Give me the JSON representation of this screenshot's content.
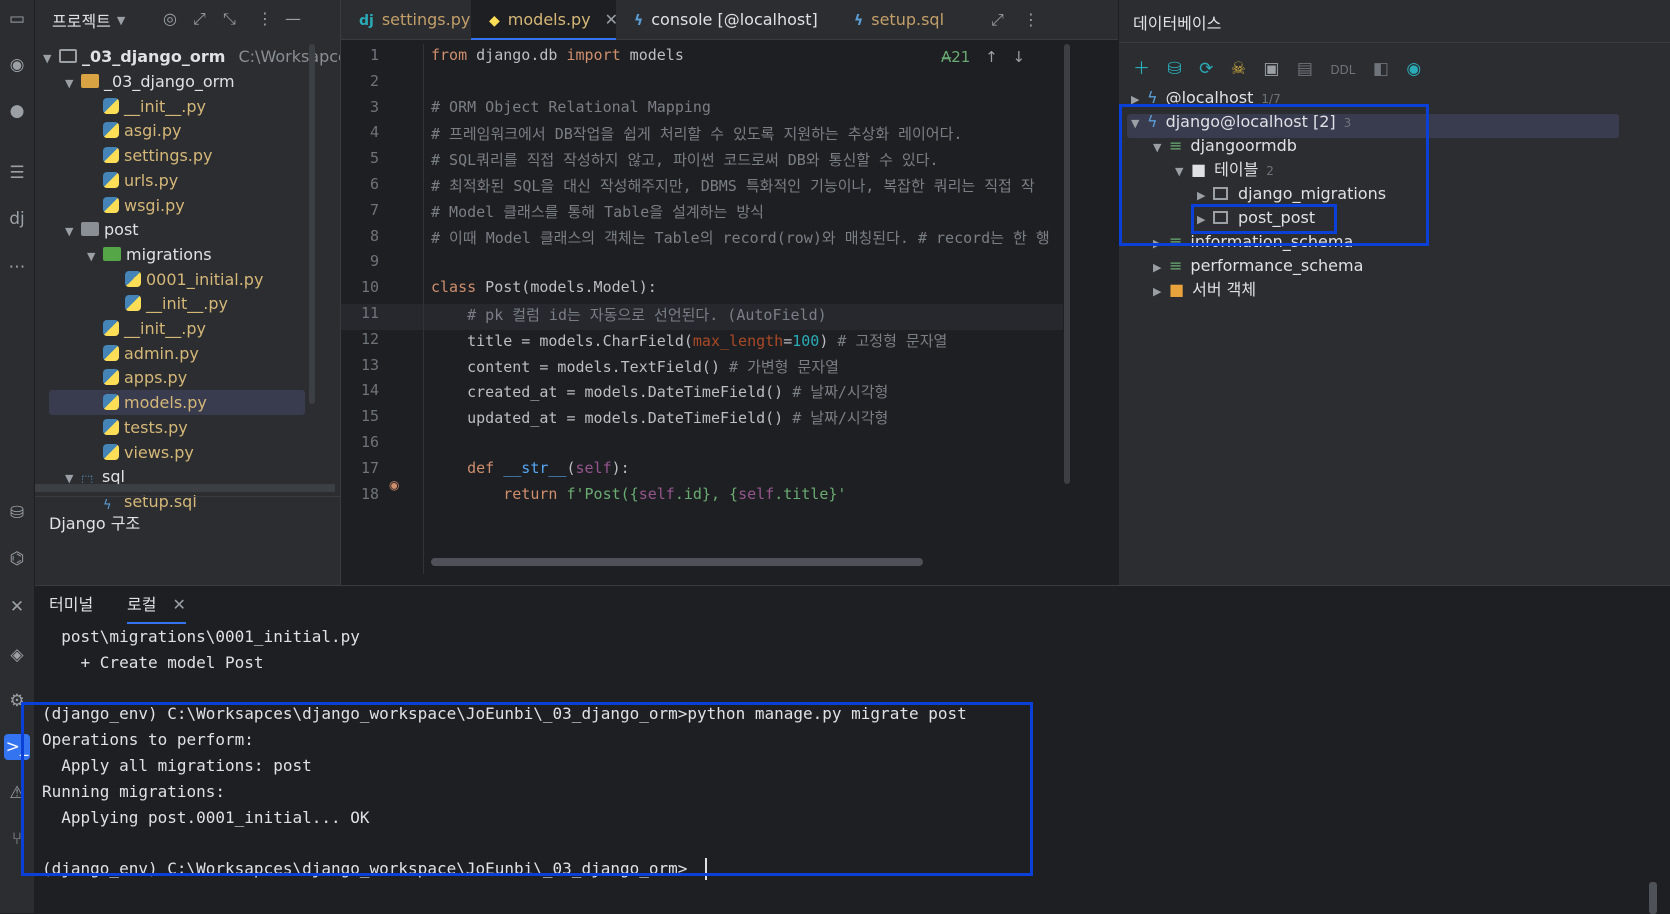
{
  "project": {
    "title": "프로젝트",
    "root": {
      "name": "_03_django_orm",
      "path": "C:\\Worksapces"
    },
    "items": [
      {
        "label": "_03_django_orm",
        "type": "folder",
        "level": 1,
        "open": true
      },
      {
        "label": "__init__.py",
        "type": "py",
        "level": 2
      },
      {
        "label": "asgi.py",
        "type": "py",
        "level": 2
      },
      {
        "label": "settings.py",
        "type": "py",
        "level": 2
      },
      {
        "label": "urls.py",
        "type": "py",
        "level": 2
      },
      {
        "label": "wsgi.py",
        "type": "py",
        "level": 2
      },
      {
        "label": "post",
        "type": "pkg",
        "level": 1,
        "open": true
      },
      {
        "label": "migrations",
        "type": "mig",
        "level": 2,
        "open": true
      },
      {
        "label": "0001_initial.py",
        "type": "py",
        "level": 3
      },
      {
        "label": "__init__.py",
        "type": "py",
        "level": 3
      },
      {
        "label": "__init__.py",
        "type": "py",
        "level": 2
      },
      {
        "label": "admin.py",
        "type": "py",
        "level": 2
      },
      {
        "label": "apps.py",
        "type": "py",
        "level": 2
      },
      {
        "label": "models.py",
        "type": "py",
        "level": 2,
        "selected": true
      },
      {
        "label": "tests.py",
        "type": "py",
        "level": 2
      },
      {
        "label": "views.py",
        "type": "py",
        "level": 2
      },
      {
        "label": "sql",
        "type": "sqlfolder",
        "level": 1,
        "open": true
      },
      {
        "label": "setup.sql",
        "type": "sql",
        "level": 2
      }
    ],
    "structure_label": "Django 구조"
  },
  "editor": {
    "tabs": [
      {
        "label": "settings.py",
        "icon": "dj"
      },
      {
        "label": "models.py",
        "icon": "py",
        "active": true
      },
      {
        "label": "console [@localhost]",
        "icon": "console"
      },
      {
        "label": "setup.sql",
        "icon": "sql"
      }
    ],
    "inspection_count": "21",
    "lines": [
      "1",
      "2",
      "3",
      "4",
      "5",
      "6",
      "7",
      "8",
      "9",
      "10",
      "11",
      "12",
      "13",
      "14",
      "15",
      "16",
      "17",
      "18"
    ],
    "code": {
      "l1": [
        "from",
        " django.db ",
        "import",
        " models"
      ],
      "l3": "# ORM Object Relational Mapping",
      "l4": "# 프레임워크에서 DB작업을 쉽게 처리할 수 있도록 지원하는 추상화 레이어다.",
      "l5": "# SQL쿼리를 직접 작성하지 않고, 파이썬 코드로써 DB와 통신할 수 있다.",
      "l6": "# 최적화된 SQL을 대신 작성해주지만, DBMS 특화적인 기능이나, 복잡한 쿼리는 직접 작",
      "l7": "# Model 클래스를 통해 Table을 설계하는 방식",
      "l8": "# 이때 Model 클래스의 객체는 Table의 record(row)와 매칭된다. # record는 한 행",
      "l10": [
        "class",
        " Post(models.Model):"
      ],
      "l11": "    # pk 컬럼 id는 자동으로 선언된다. (AutoField)",
      "l12": [
        "    title = models.CharField(",
        "max_length",
        "=",
        "100",
        ") ",
        "# 고정형 문자열"
      ],
      "l13": [
        "    content = models.TextField() ",
        "# 가변형 문자열"
      ],
      "l14": [
        "    created_at = models.DateTimeField() ",
        "# 날짜/시각형"
      ],
      "l15": [
        "    updated_at = models.DateTimeField() ",
        "# 날짜/시각형"
      ],
      "l17": [
        "    ",
        "def",
        " ",
        "__str__",
        "(",
        "self",
        "):"
      ],
      "l18": [
        "        return ",
        "f'Post({",
        "self",
        ".id}, {",
        "self",
        ".title}'"
      ]
    }
  },
  "database": {
    "title": "데이터베이스",
    "toolbar": [
      "add-icon",
      "datasource-icon",
      "refresh-icon",
      "skull-icon",
      "console-icon",
      "schema-icon",
      "DDL",
      "compare-icon",
      "eye-icon"
    ],
    "ddl_label": "DDL",
    "items": [
      {
        "label": "@localhost",
        "badge": "1/7",
        "level": 0
      },
      {
        "label": "django@localhost [2]",
        "badge": "3",
        "level": 0,
        "open": true
      },
      {
        "label": "djangoormdb",
        "level": 1,
        "open": true
      },
      {
        "label": "테이블",
        "badge": "2",
        "level": 2,
        "open": true
      },
      {
        "label": "django_migrations",
        "level": 3
      },
      {
        "label": "post_post",
        "level": 3
      },
      {
        "label": "information_schema",
        "level": 1
      },
      {
        "label": "performance_schema",
        "level": 1
      },
      {
        "label": "서버 객체",
        "level": 1
      }
    ]
  },
  "terminal": {
    "tabs": [
      {
        "label": "터미널"
      },
      {
        "label": "로컬",
        "active": true
      }
    ],
    "lines": [
      "  post\\migrations\\0001_initial.py",
      "    + Create model Post",
      "",
      "(django_env) C:\\Worksapces\\django_workspace\\JoEunbi\\_03_django_orm>python manage.py migrate post",
      "Operations to perform:",
      "  Apply all migrations: post",
      "Running migrations:",
      "  Applying post.0001_initial... OK",
      "",
      "(django_env) C:\\Worksapces\\django_workspace\\JoEunbi\\_03_django_orm>"
    ]
  },
  "colors": {
    "highlight_box": "#0a3fd8",
    "accent": "#3574f0"
  }
}
